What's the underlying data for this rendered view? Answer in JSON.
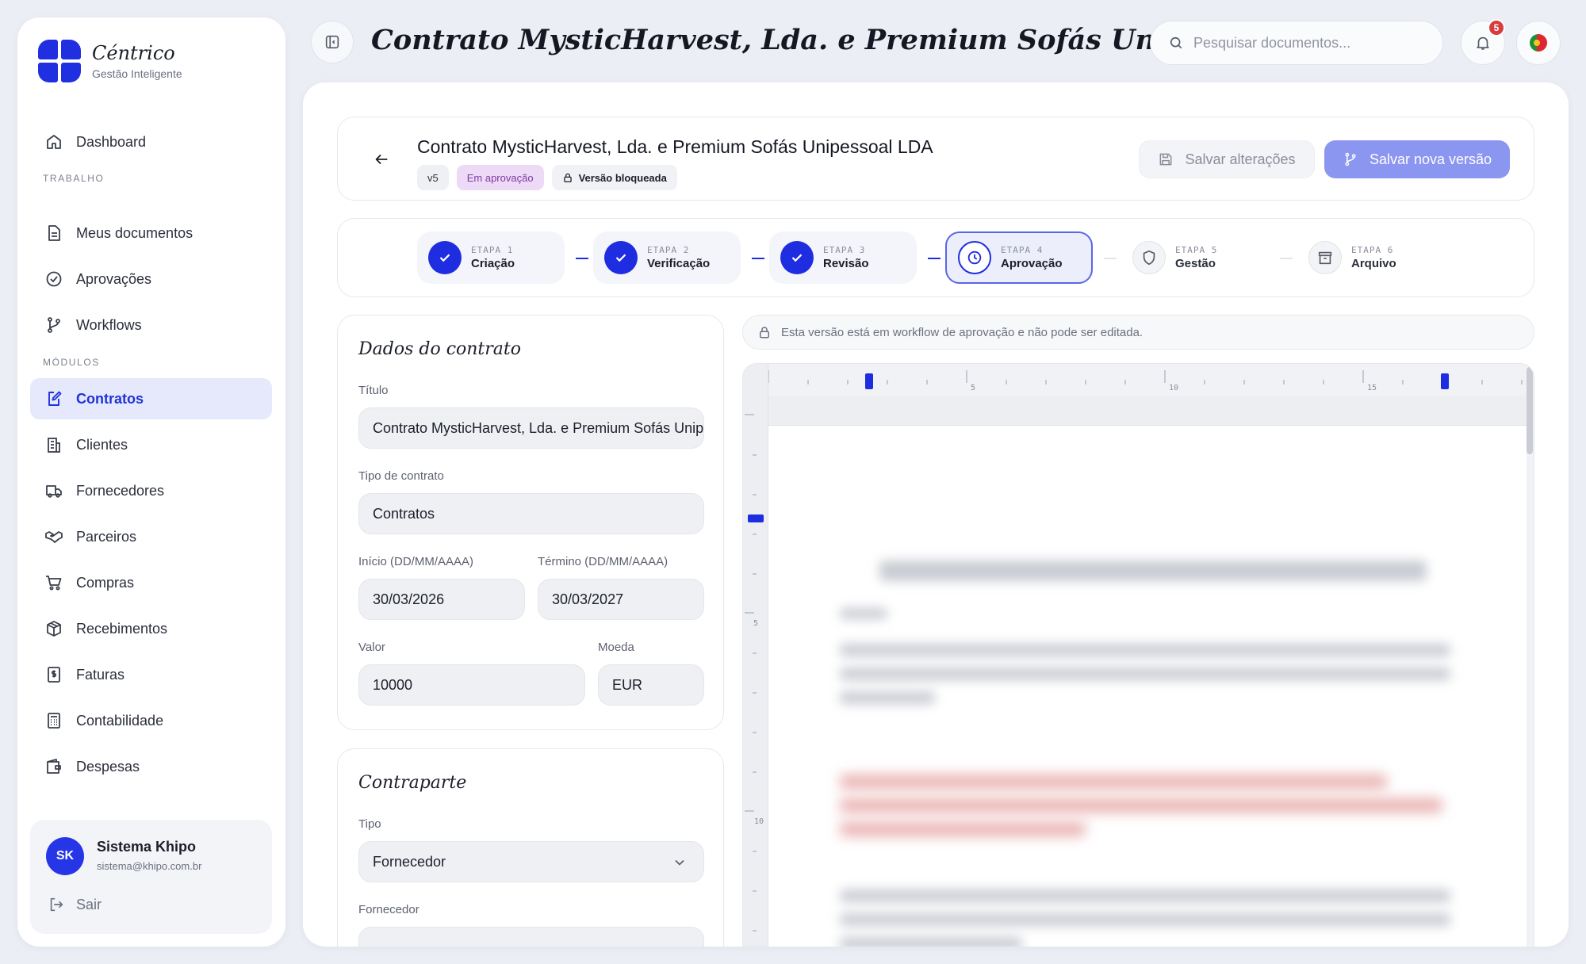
{
  "brand": {
    "name": "Céntrico",
    "subtitle": "Gestão Inteligente"
  },
  "sidebar": {
    "dashboard": "Dashboard",
    "section_work": "TRABALHO",
    "work_items": [
      {
        "label": "Meus documentos",
        "icon": "document-icon"
      },
      {
        "label": "Aprovações",
        "icon": "check-circle-icon"
      },
      {
        "label": "Workflows",
        "icon": "branch-icon"
      }
    ],
    "section_modules": "MÓDULOS",
    "module_items": [
      {
        "label": "Contratos",
        "icon": "edit-document-icon",
        "active": true
      },
      {
        "label": "Clientes",
        "icon": "building-icon"
      },
      {
        "label": "Fornecedores",
        "icon": "truck-icon"
      },
      {
        "label": "Parceiros",
        "icon": "handshake-icon"
      },
      {
        "label": "Compras",
        "icon": "cart-icon"
      },
      {
        "label": "Recebimentos",
        "icon": "package-icon"
      },
      {
        "label": "Faturas",
        "icon": "invoice-icon"
      },
      {
        "label": "Contabilidade",
        "icon": "calculator-icon"
      },
      {
        "label": "Despesas",
        "icon": "wallet-icon"
      }
    ],
    "user": {
      "initials": "SK",
      "name": "Sistema Khipo",
      "email": "sistema@khipo.com.br",
      "logout": "Sair"
    }
  },
  "topbar": {
    "title": "Contrato MysticHarvest, Lda. e Premium Sofás Unipessoal LDA",
    "search_placeholder": "Pesquisar documentos...",
    "notifications_count": "5"
  },
  "document": {
    "title": "Contrato MysticHarvest, Lda. e Premium Sofás Unipessoal LDA",
    "version": "v5",
    "status": "Em aprovação",
    "lock_label": "Versão bloqueada",
    "save_label": "Salvar alterações",
    "save_new_label": "Salvar nova versão"
  },
  "steps": [
    {
      "etapa": "ETAPA 1",
      "name": "Criação",
      "state": "done"
    },
    {
      "etapa": "ETAPA 2",
      "name": "Verificação",
      "state": "done"
    },
    {
      "etapa": "ETAPA 3",
      "name": "Revisão",
      "state": "done"
    },
    {
      "etapa": "ETAPA 4",
      "name": "Aprovação",
      "state": "current"
    },
    {
      "etapa": "ETAPA 5",
      "name": "Gestão",
      "state": "pending"
    },
    {
      "etapa": "ETAPA 6",
      "name": "Arquivo",
      "state": "pending"
    }
  ],
  "form": {
    "title": "Dados do contrato",
    "titulo_label": "Título",
    "titulo_value": "Contrato MysticHarvest, Lda. e Premium Sofás Unipessoal LDA",
    "tipo_label": "Tipo de contrato",
    "tipo_value": "Contratos",
    "inicio_label": "Início (DD/MM/AAAA)",
    "inicio_value": "30/03/2026",
    "termino_label": "Término (DD/MM/AAAA)",
    "termino_value": "30/03/2027",
    "valor_label": "Valor",
    "valor_value": "10000",
    "moeda_label": "Moeda",
    "moeda_value": "EUR"
  },
  "counterparty": {
    "title": "Contraparte",
    "tipo_label": "Tipo",
    "tipo_value": "Fornecedor",
    "fornecedor_label": "Fornecedor"
  },
  "editor": {
    "notice": "Esta versão está em workflow de aprovação e não pode ser editada.",
    "ruler_h": [
      "5",
      "10",
      "15"
    ],
    "ruler_v": [
      "5",
      "10"
    ]
  }
}
